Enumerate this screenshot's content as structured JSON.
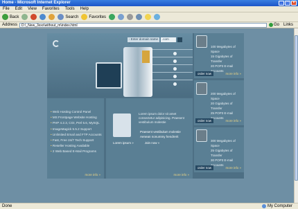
{
  "window": {
    "title": "Home - Microsoft Internet Explorer"
  },
  "menu": [
    "File",
    "Edit",
    "View",
    "Favorites",
    "Tools",
    "Help"
  ],
  "toolbar": {
    "back": "Back",
    "search": "Search",
    "favorites": "Favorites"
  },
  "address": {
    "label": "Address",
    "value": "D:\\_New_3xxx\\without_m\\index.html",
    "go": "Go",
    "links": "Links"
  },
  "status": {
    "left": "Done",
    "right": "My Computer"
  },
  "site": {
    "domain_placeholder": "- Enter domain name -",
    "tld": ".com",
    "plans": [
      {
        "lines": [
          "100 Megabytes of Space",
          "15 Gigabytes of Transfer",
          "20 POP3 E-mail Accounts"
        ],
        "order": "order now",
        "more": "more info »"
      },
      {
        "lines": [
          "200 Megabytes of Space",
          "20 Gigabytes of Transfer",
          "25 POP3 E-mail Accounts"
        ],
        "order": "order now",
        "more": "more info »"
      },
      {
        "lines": [
          "300 Megabytes of Space",
          "25 Gigabytes of Transfer",
          "30 POP3 E-mail Accounts"
        ],
        "order": "order now",
        "more": "more info »"
      }
    ],
    "features": [
      "Web Hosting Control Panel",
      "MS Frontpage Website Hosting",
      "PHP 4.2.3, CGI, Perl 5.6, MySQL",
      "ImageMagick 5.5.2 Support",
      "Unlimited Email and FTP Accounts",
      "Fast, Free 24/7 Tech Support",
      "Reseller Hosting Available",
      "2 Web Based E-Mail Programs"
    ],
    "features_more": "more info »",
    "bio": "Lorem ipsum dolor sit amet consectetur adipisicing. Praesent vestibulum molestie",
    "bio_list": [
      "Praesent vestibulum molestie",
      "Aenean nonummy hendrerit"
    ],
    "bio_links": [
      "Lorem ipsum »",
      "Join now »"
    ],
    "bio_more": "more info »"
  }
}
